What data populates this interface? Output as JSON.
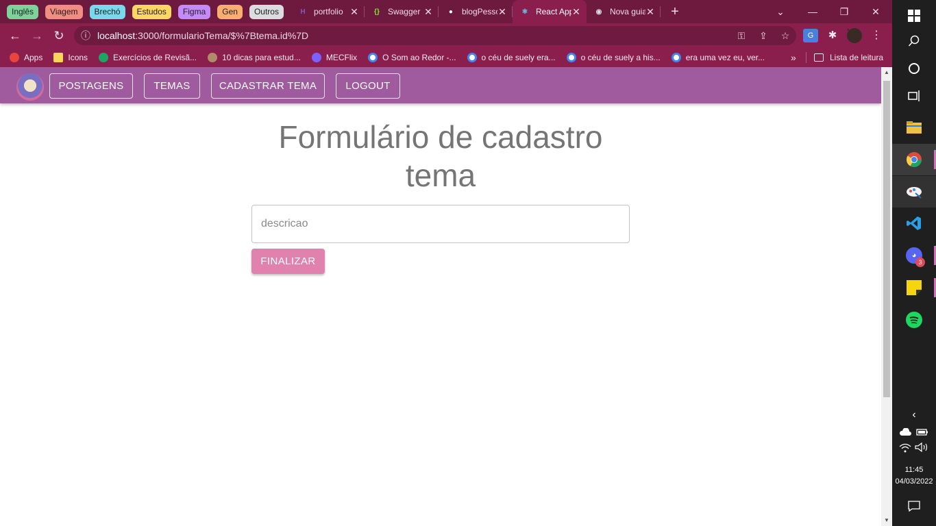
{
  "browser": {
    "tab_groups": [
      {
        "label": "Inglês",
        "color": "#7ed39b"
      },
      {
        "label": "Viagem",
        "color": "#f28b82"
      },
      {
        "label": "Brechó",
        "color": "#78d9ec"
      },
      {
        "label": "Estudos",
        "color": "#fdd663"
      },
      {
        "label": "Figma",
        "color": "#c58af9"
      },
      {
        "label": "Gen",
        "color": "#fcad70"
      },
      {
        "label": "Outros",
        "color": "#dadce0"
      }
    ],
    "tabs": [
      {
        "title": "portfolio",
        "icon": "heroku-icon",
        "close": "✕",
        "icon_color": "#7e5bbe",
        "icon_glyph": "H"
      },
      {
        "title": "Swagger",
        "icon": "swagger-icon",
        "close": "✕",
        "icon_color": "#85ea2d",
        "icon_glyph": "{}"
      },
      {
        "title": "blogPessoal",
        "icon": "github-icon",
        "close": "✕",
        "icon_color": "#ffffff",
        "icon_glyph": "●"
      },
      {
        "title": "React App",
        "icon": "react-icon",
        "close": "✕",
        "icon_color": "#61dafb",
        "icon_glyph": "⚛",
        "active": true
      },
      {
        "title": "Nova guia",
        "icon": "chrome-icon",
        "close": "✕",
        "icon_color": "#dadce0",
        "icon_glyph": "◉"
      }
    ],
    "new_tab": "+",
    "window_controls": {
      "dropdown": "⌄",
      "minimize": "—",
      "restore": "❐",
      "close": "✕"
    },
    "address": {
      "host": "localhost",
      "path": ":3000/formularioTema/$%7Btema.id%7D"
    },
    "nav": {
      "back": "←",
      "forward": "→",
      "reload": "↻",
      "info": "ⓘ"
    },
    "omni_icons": [
      "⚿",
      "⇪",
      "☆"
    ],
    "toolbar_icons": [
      "G",
      "✱",
      "●",
      "⋮"
    ],
    "bookmarks": [
      {
        "label": "Apps",
        "icon": "apps-icon",
        "color": "#e8453c"
      },
      {
        "label": "Icons",
        "icon": "folder-icon",
        "color": "#f9d55b"
      },
      {
        "label": "Exercícios de Revisã...",
        "icon": "drive-icon",
        "color": "#1fa463"
      },
      {
        "label": "10 dicas para estud...",
        "icon": "avatar-icon",
        "color": "#b08a6a"
      },
      {
        "label": "MECFlix",
        "icon": "mecflix-icon",
        "color": "#7b61ff"
      },
      {
        "label": "O Som ao Redor -...",
        "icon": "google-icon",
        "color": "#ffffff"
      },
      {
        "label": "o céu de suely era...",
        "icon": "google-icon",
        "color": "#ffffff"
      },
      {
        "label": "o céu de suely a his...",
        "icon": "google-icon",
        "color": "#ffffff"
      },
      {
        "label": "era uma vez eu, ver...",
        "icon": "google-icon",
        "color": "#ffffff"
      }
    ],
    "bookmarks_overflow": "»",
    "reading_list": "Lista de leitura"
  },
  "app": {
    "nav": [
      {
        "label": "POSTAGENS"
      },
      {
        "label": "TEMAS"
      },
      {
        "label": "CADASTRAR TEMA"
      },
      {
        "label": "LOGOUT"
      }
    ],
    "form": {
      "title": "Formulário de cadastro tema",
      "description_placeholder": "descricao",
      "description_value": "",
      "submit_label": "FINALIZAR"
    },
    "colors": {
      "appbar": "#a05a9e",
      "button": "#e082ad",
      "title": "#757575"
    }
  },
  "taskbar": {
    "apps": [
      "windows-icon",
      "search-icon",
      "cortana-icon",
      "task-view-icon",
      "file-explorer-icon",
      "chrome-icon",
      "paint-icon",
      "vscode-icon",
      "discord-icon",
      "sticky-notes-icon",
      "spotify-icon"
    ],
    "discord_badge": "3",
    "tray": {
      "chevron": "‹",
      "time": "11:45",
      "date": "04/03/2022"
    }
  }
}
